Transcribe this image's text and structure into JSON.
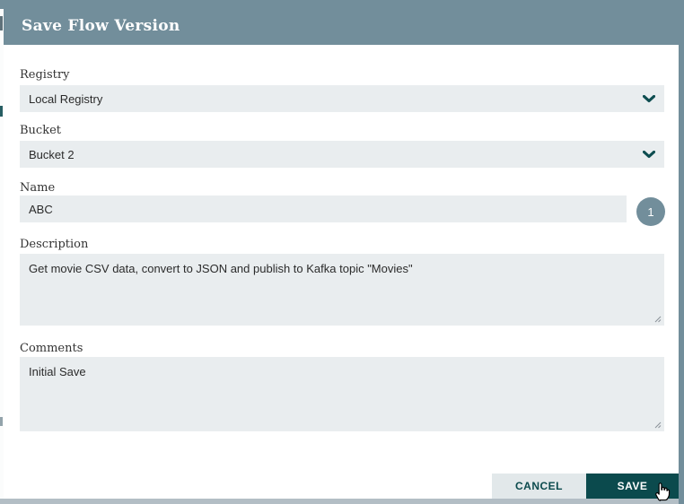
{
  "dialog": {
    "title": "Save Flow Version",
    "fields": [
      {
        "id": "registry",
        "label": "Registry",
        "type": "select",
        "value": "Local Registry"
      },
      {
        "id": "bucket",
        "label": "Bucket",
        "type": "select",
        "value": "Bucket 2"
      },
      {
        "id": "name",
        "label": "Name",
        "type": "text",
        "value": "ABC",
        "badge": "1"
      },
      {
        "id": "description",
        "label": "Description",
        "type": "textarea",
        "value": "Get movie CSV data, convert to JSON and publish to Kafka topic \"Movies\""
      },
      {
        "id": "comments",
        "label": "Comments",
        "type": "textarea",
        "value": "Initial Save"
      }
    ],
    "buttons": {
      "cancel": "CANCEL",
      "save": "SAVE"
    }
  },
  "icons": {
    "select_chevron": "chevron-down",
    "textarea_resize": "resize-handle",
    "pointer": "hand-pointer-cursor"
  },
  "colors": {
    "header": "#728e9b",
    "backdrop": "#728e9b",
    "primary_teal": "#0b4a4d",
    "field_background": "#e9edef",
    "cancel_background": "#e2e8ea",
    "badge": "#728e9b",
    "bottom_strip": "#b3bec5"
  }
}
